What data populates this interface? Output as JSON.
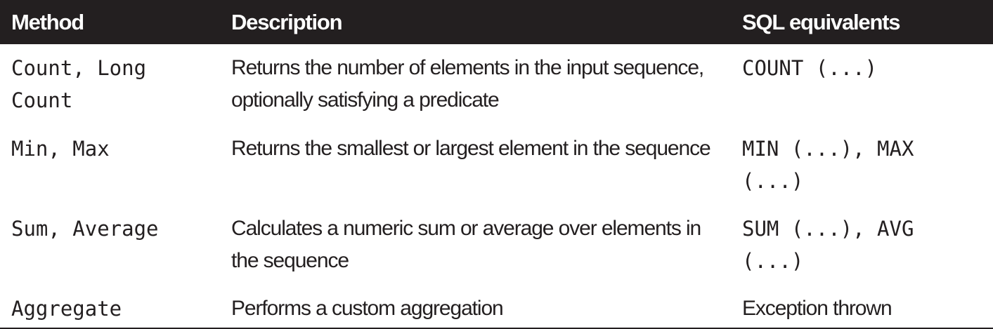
{
  "table": {
    "headers": [
      "Method",
      "Description",
      "SQL equivalents"
    ],
    "rows": [
      {
        "method": "Count, Long Count",
        "description": "Returns the number of elements in the input sequence, optionally satisfying a predicate",
        "sql": "COUNT (...)"
      },
      {
        "method": "Min, Max",
        "description": "Returns the smallest or largest element in the sequence",
        "sql": "MIN (...), MAX (...)"
      },
      {
        "method": "Sum, Average",
        "description": "Calculates a numeric sum or average over elements in the sequence",
        "sql": "SUM (...), AVG (...)"
      },
      {
        "method": "Aggregate",
        "description": "Performs a custom aggregation",
        "sql": "Exception thrown"
      }
    ]
  }
}
